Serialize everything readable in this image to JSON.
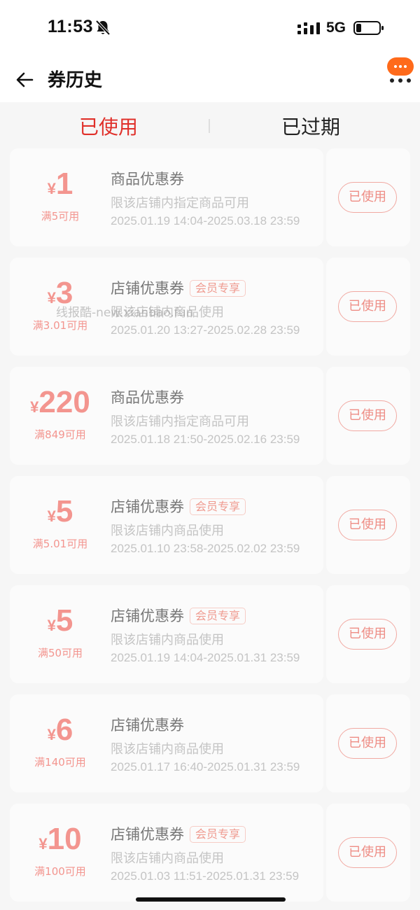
{
  "status_bar": {
    "time": "11:53",
    "network": "5G",
    "icons": [
      "bell-muted-icon",
      "signal-icon",
      "battery-icon"
    ]
  },
  "nav": {
    "title": "券历史",
    "back_icon": "back-arrow-icon",
    "more_icon": "more-bubble-icon",
    "accent": "#ff6a1a"
  },
  "tabs": [
    {
      "label": "已使用",
      "active": true
    },
    {
      "label": "已过期",
      "active": false
    }
  ],
  "colors": {
    "active_tab": "#e0302a",
    "coupon_amount": "#f3958f",
    "used_button": "#ee8d85",
    "page_bg": "#f6f6f6"
  },
  "coupons": [
    {
      "currency": "¥",
      "value": "1",
      "threshold": "满5可用",
      "title": "商品优惠券",
      "badge": "",
      "scope": "限该店铺内指定商品可用",
      "validity": "2025.01.19 14:04-2025.03.18 23:59",
      "status": "已使用"
    },
    {
      "currency": "¥",
      "value": "3",
      "threshold": "满3.01可用",
      "title": "店铺优惠券",
      "badge": "会员专享",
      "scope": "限该店铺内商品使用",
      "validity": "2025.01.20 13:27-2025.02.28 23:59",
      "status": "已使用"
    },
    {
      "currency": "¥",
      "value": "220",
      "threshold": "满849可用",
      "title": "商品优惠券",
      "badge": "",
      "scope": "限该店铺内指定商品可用",
      "validity": "2025.01.18 21:50-2025.02.16 23:59",
      "status": "已使用"
    },
    {
      "currency": "¥",
      "value": "5",
      "threshold": "满5.01可用",
      "title": "店铺优惠券",
      "badge": "会员专享",
      "scope": "限该店铺内商品使用",
      "validity": "2025.01.10 23:58-2025.02.02 23:59",
      "status": "已使用"
    },
    {
      "currency": "¥",
      "value": "5",
      "threshold": "满50可用",
      "title": "店铺优惠券",
      "badge": "会员专享",
      "scope": "限该店铺内商品使用",
      "validity": "2025.01.19 14:04-2025.01.31 23:59",
      "status": "已使用"
    },
    {
      "currency": "¥",
      "value": "6",
      "threshold": "满140可用",
      "title": "店铺优惠券",
      "badge": "",
      "scope": "限该店铺内商品使用",
      "validity": "2025.01.17 16:40-2025.01.31 23:59",
      "status": "已使用"
    },
    {
      "currency": "¥",
      "value": "10",
      "threshold": "满100可用",
      "title": "店铺优惠券",
      "badge": "会员专享",
      "scope": "限该店铺内商品使用",
      "validity": "2025.01.03 11:51-2025.01.31 23:59",
      "status": "已使用"
    }
  ],
  "watermark": "线报酷-new.xianbao.fun"
}
